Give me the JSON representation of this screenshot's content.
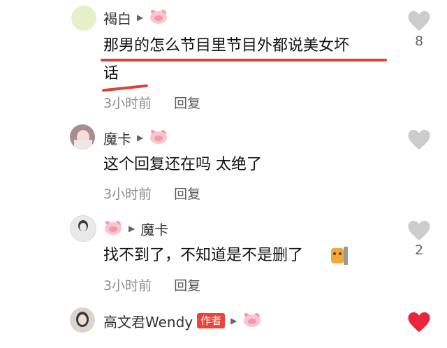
{
  "colors": {
    "heart_inactive": "#cccccc",
    "heart_active": "#e8253b",
    "author_badge": "#e8453c",
    "underline_annotation": "#d9433a"
  },
  "comments": [
    {
      "author": "褐白",
      "text_line1": "那男的怎么节目里节目外都说美女坏",
      "text_line2": "话",
      "time": "3小时前",
      "reply_label": "回复",
      "likes": "8",
      "liked": false
    },
    {
      "author": "魔卡",
      "text_line1": "这个回复还在吗 太绝了",
      "time": "3小时前",
      "reply_label": "回复",
      "likes": "",
      "liked": false
    },
    {
      "author": "魔卡",
      "text_line1": "找不到了，不知道是不是删了",
      "time": "3小时前",
      "reply_label": "回复",
      "likes": "2",
      "liked": false
    },
    {
      "author": "高文君Wendy",
      "badge": "作者",
      "liked": true
    }
  ]
}
